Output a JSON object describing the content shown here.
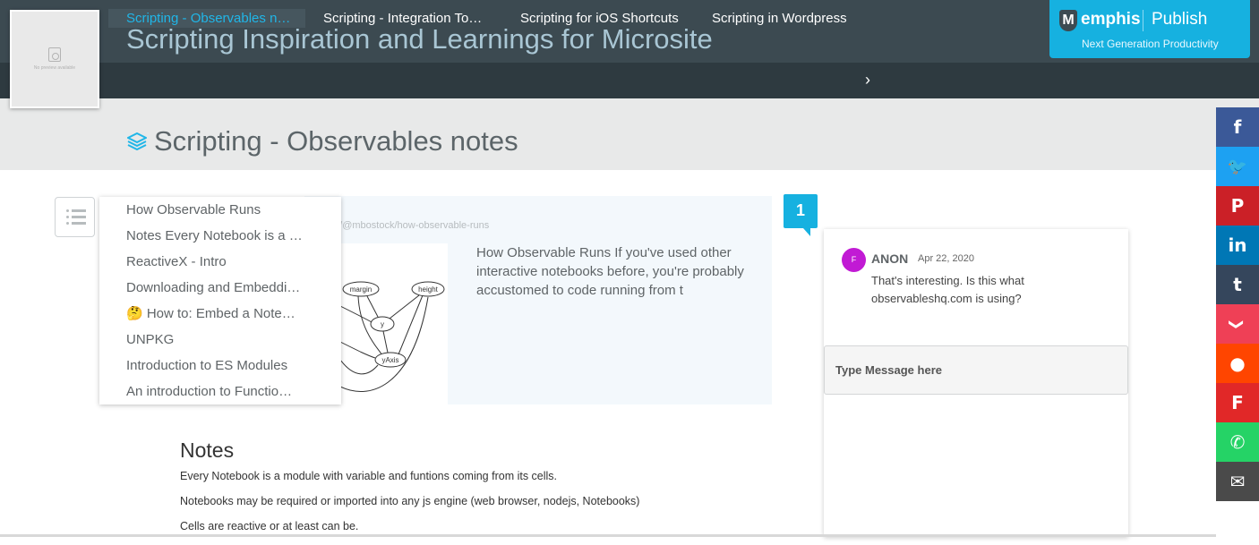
{
  "header": {
    "thumbnail_text": "No preview available",
    "site_title": "Scripting Inspiration and Learnings for Microsite",
    "nav": [
      {
        "label": "Scripting - Observables n…",
        "active": true
      },
      {
        "label": "Scripting - Integration To…",
        "active": false
      },
      {
        "label": "Scripting for iOS Shortcuts",
        "active": false
      },
      {
        "label": "Scripting in Wordpress",
        "active": false
      }
    ],
    "nav_next": "›",
    "brand": {
      "logo_letter": "M",
      "name": "emphis",
      "publish": "Publish",
      "tagline": "Next Generation Productivity"
    }
  },
  "page": {
    "title": "Scripting - Observables notes"
  },
  "toc": [
    "How Observable Runs",
    "Notes Every Notebook is a …",
    "ReactiveX - Intro",
    "Downloading and Embeddi…",
    "🤔 How to: Embed a Note…",
    "UNPKG",
    "Introduction to ES Modules",
    "An introduction to Functio…"
  ],
  "card": {
    "url": "m/@mbostock/how-observable-runs",
    "diagram_labels": [
      "margin",
      "height",
      "y",
      "yAxis"
    ],
    "text": "How Observable Runs If you've used other interactive notebooks before, you're probably accustomed to code running from t"
  },
  "notes": {
    "heading": "Notes",
    "paragraphs": [
      "Every Notebook is a module with variable and funtions coming from its cells.",
      "Notebooks may be required or imported into any js engine (web browser, nodejs, Notebooks)",
      "Cells are reactive or at least can be."
    ]
  },
  "comments": {
    "count": "1",
    "items": [
      {
        "avatar": "F",
        "author": "ANON",
        "date": "Apr 22, 2020",
        "body": "That's interesting. Is this what observableshq.com is using?"
      }
    ],
    "input_placeholder": "Type Message here"
  },
  "share": [
    {
      "name": "facebook",
      "glyph": "f",
      "color": "#3b5998"
    },
    {
      "name": "twitter",
      "glyph": "🐦",
      "color": "#1da1f2"
    },
    {
      "name": "pinterest",
      "glyph": "P",
      "color": "#cb2027"
    },
    {
      "name": "linkedin",
      "glyph": "in",
      "color": "#0077b5"
    },
    {
      "name": "tumblr",
      "glyph": "t",
      "color": "#35465c"
    },
    {
      "name": "pocket",
      "glyph": "❯",
      "color": "#ef4056"
    },
    {
      "name": "reddit",
      "glyph": "●",
      "color": "#ff4500"
    },
    {
      "name": "flipboard",
      "glyph": "F",
      "color": "#e12828"
    },
    {
      "name": "whatsapp",
      "glyph": "✆",
      "color": "#25d366"
    },
    {
      "name": "email",
      "glyph": "✉",
      "color": "#4a4a4a"
    }
  ],
  "colors": {
    "accent": "#16b1e0",
    "header_bg": "#3c4a51",
    "nav_bg": "#2e3a40"
  }
}
